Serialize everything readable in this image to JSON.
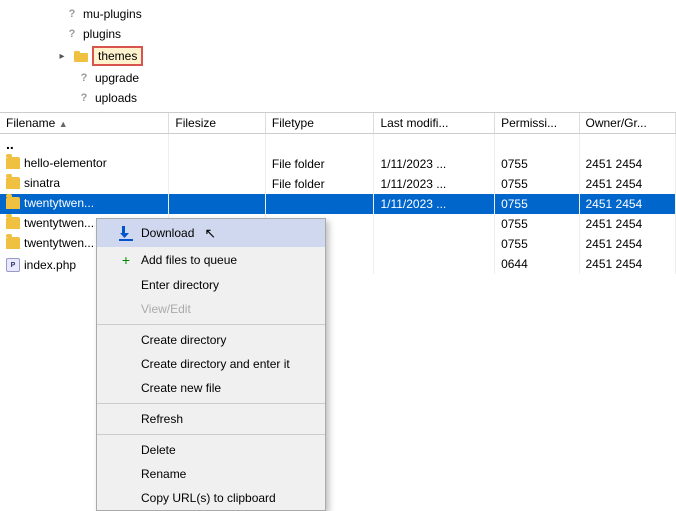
{
  "tree": {
    "items": [
      {
        "id": "mu-plugins",
        "label": "mu-plugins",
        "indent": 60,
        "type": "question",
        "expanded": false
      },
      {
        "id": "plugins",
        "label": "plugins",
        "indent": 60,
        "type": "question",
        "expanded": false
      },
      {
        "id": "themes",
        "label": "themes",
        "indent": 60,
        "type": "folder",
        "expanded": true,
        "highlighted": true
      },
      {
        "id": "upgrade",
        "label": "upgrade",
        "indent": 76,
        "type": "question",
        "expanded": false
      },
      {
        "id": "uploads",
        "label": "uploads",
        "indent": 76,
        "type": "question",
        "expanded": false
      }
    ]
  },
  "fileList": {
    "columns": [
      {
        "id": "filename",
        "label": "Filename",
        "sortable": true
      },
      {
        "id": "filesize",
        "label": "Filesize"
      },
      {
        "id": "filetype",
        "label": "Filetype"
      },
      {
        "id": "modified",
        "label": "Last modifi..."
      },
      {
        "id": "permissions",
        "label": "Permissi..."
      },
      {
        "id": "owner",
        "label": "Owner/Gr..."
      }
    ],
    "rows": [
      {
        "id": "dotdot",
        "filename": "..",
        "filesize": "",
        "filetype": "",
        "modified": "",
        "permissions": "",
        "owner": "",
        "iconType": "dotdot"
      },
      {
        "id": "hello-elementor",
        "filename": "hello-elementor",
        "filesize": "",
        "filetype": "File folder",
        "modified": "1/11/2023 ...",
        "permissions": "0755",
        "owner": "2451 2454",
        "iconType": "folder"
      },
      {
        "id": "sinatra",
        "filename": "sinatra",
        "filesize": "",
        "filetype": "File folder",
        "modified": "1/11/2023 ...",
        "permissions": "0755",
        "owner": "2451 2454",
        "iconType": "folder"
      },
      {
        "id": "twentytwen1",
        "filename": "twentytwen...",
        "filesize": "",
        "filetype": "",
        "modified": "1/11/2023 ...",
        "permissions": "0755",
        "owner": "2451 2454",
        "iconType": "folder",
        "selected": true
      },
      {
        "id": "twentytwen2",
        "filename": "twentytwen...",
        "filesize": "",
        "filetype": "",
        "modified": "",
        "permissions": "0755",
        "owner": "2451 2454",
        "iconType": "folder"
      },
      {
        "id": "twentytwen3",
        "filename": "twentytwen...",
        "filesize": "",
        "filetype": "",
        "modified": "",
        "permissions": "0755",
        "owner": "2451 2454",
        "iconType": "folder"
      },
      {
        "id": "index-php",
        "filename": "index.php",
        "filesize": "",
        "filetype": "",
        "modified": "",
        "permissions": "0644",
        "owner": "2451 2454",
        "iconType": "php"
      }
    ]
  },
  "contextMenu": {
    "items": [
      {
        "id": "download",
        "label": "Download",
        "icon": "download-arrow",
        "hovered": true,
        "disabled": false,
        "separator_after": false
      },
      {
        "id": "add-files-queue",
        "label": "Add files to queue",
        "icon": "add-plus",
        "hovered": false,
        "disabled": false,
        "separator_after": false
      },
      {
        "id": "enter-directory",
        "label": "Enter directory",
        "icon": null,
        "hovered": false,
        "disabled": false,
        "separator_after": false
      },
      {
        "id": "view-edit",
        "label": "View/Edit",
        "icon": null,
        "hovered": false,
        "disabled": true,
        "separator_after": true
      },
      {
        "id": "create-directory",
        "label": "Create directory",
        "icon": null,
        "hovered": false,
        "disabled": false,
        "separator_after": false
      },
      {
        "id": "create-directory-enter",
        "label": "Create directory and enter it",
        "icon": null,
        "hovered": false,
        "disabled": false,
        "separator_after": false
      },
      {
        "id": "create-new-file",
        "label": "Create new file",
        "icon": null,
        "hovered": false,
        "disabled": false,
        "separator_after": true
      },
      {
        "id": "refresh",
        "label": "Refresh",
        "icon": null,
        "hovered": false,
        "disabled": false,
        "separator_after": true
      },
      {
        "id": "delete",
        "label": "Delete",
        "icon": null,
        "hovered": false,
        "disabled": false,
        "separator_after": false
      },
      {
        "id": "rename",
        "label": "Rename",
        "icon": null,
        "hovered": false,
        "disabled": false,
        "separator_after": false
      },
      {
        "id": "copy-url",
        "label": "Copy URL(s) to clipboard",
        "icon": null,
        "hovered": false,
        "disabled": false,
        "separator_after": false
      }
    ]
  }
}
